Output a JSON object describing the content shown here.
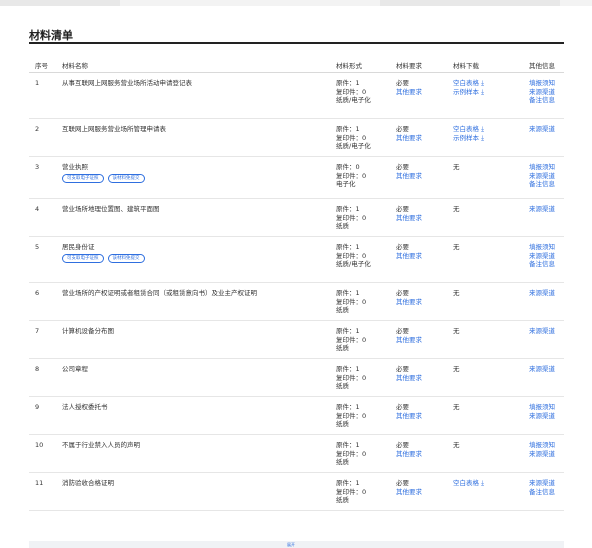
{
  "page": {
    "title": "材料清单"
  },
  "table": {
    "headers": {
      "no": "序号",
      "name": "材料名称",
      "form": "材料形式",
      "req": "材料要求",
      "download": "材料下载",
      "other": "其他信息"
    },
    "rows": [
      {
        "no": "1",
        "name": "从事互联网上网服务营业场所活动申请登记表",
        "tags": [],
        "form": [
          "原件：1",
          "复印件：0",
          "纸质/电子化"
        ],
        "req": "必要",
        "req_link": "其他要求",
        "download": [
          "空白表格 ⤓",
          "示例样本 ⤓"
        ],
        "other": [
          "填报须知",
          "来源渠道",
          "备注信息"
        ]
      },
      {
        "no": "2",
        "name": "互联网上网服务营业场所管理申请表",
        "tags": [],
        "form": [
          "原件：1",
          "复印件：0",
          "纸质/电子化"
        ],
        "req": "必要",
        "req_link": "其他要求",
        "download": [
          "空白表格 ⤓",
          "示例样本 ⤓"
        ],
        "other": [
          "来源渠道"
        ]
      },
      {
        "no": "3",
        "name": "营业执照",
        "tags": [
          "可支取电子证照",
          "该材料免提交"
        ],
        "form": [
          "原件：0",
          "复印件：0",
          "电子化"
        ],
        "req": "必要",
        "req_link": "其他要求",
        "download_none": "无",
        "other": [
          "填报须知",
          "来源渠道",
          "备注信息"
        ]
      },
      {
        "no": "4",
        "name": "营业场所地理位置图、建筑平面图",
        "tags": [],
        "form": [
          "原件：1",
          "复印件：0",
          "纸质"
        ],
        "req": "必要",
        "req_link": "其他要求",
        "download_none": "无",
        "other": [
          "来源渠道"
        ]
      },
      {
        "no": "5",
        "name": "居民身份证",
        "tags": [
          "可支取电子证照",
          "该材料免提交"
        ],
        "form": [
          "原件：1",
          "复印件：0",
          "纸质/电子化"
        ],
        "req": "必要",
        "req_link": "其他要求",
        "download_none": "无",
        "other": [
          "填报须知",
          "来源渠道",
          "备注信息"
        ]
      },
      {
        "no": "6",
        "name": "营业场所的产权证明或者租赁合同（或租赁意向书）及业主产权证明",
        "tags": [],
        "form": [
          "原件：1",
          "复印件：0",
          "纸质"
        ],
        "req": "必要",
        "req_link": "其他要求",
        "download_none": "无",
        "other": [
          "来源渠道"
        ]
      },
      {
        "no": "7",
        "name": "计算机设备分布图",
        "tags": [],
        "form": [
          "原件：1",
          "复印件：0",
          "纸质"
        ],
        "req": "必要",
        "req_link": "其他要求",
        "download_none": "无",
        "other": [
          "来源渠道"
        ]
      },
      {
        "no": "8",
        "name": "公司章程",
        "tags": [],
        "form": [
          "原件：1",
          "复印件：0",
          "纸质"
        ],
        "req": "必要",
        "req_link": "其他要求",
        "download_none": "无",
        "other": [
          "来源渠道"
        ]
      },
      {
        "no": "9",
        "name": "法人授权委托书",
        "tags": [],
        "form": [
          "原件：1",
          "复印件：0",
          "纸质"
        ],
        "req": "必要",
        "req_link": "其他要求",
        "download_none": "无",
        "other": [
          "填报须知",
          "来源渠道"
        ]
      },
      {
        "no": "10",
        "name": "不属于行业禁入人员的声明",
        "tags": [],
        "form": [
          "原件：1",
          "复印件：0",
          "纸质"
        ],
        "req": "必要",
        "req_link": "其他要求",
        "download_none": "无",
        "other": [
          "填报须知",
          "来源渠道"
        ]
      },
      {
        "no": "11",
        "name": "消防验收合格证明",
        "tags": [],
        "form": [
          "原件：1",
          "复印件：0",
          "纸质"
        ],
        "req": "必要",
        "req_link": "其他要求",
        "download": [
          "空白表格 ⤓"
        ],
        "other": [
          "来源渠道",
          "备注信息"
        ]
      }
    ]
  },
  "footer": {
    "more_label": "展开"
  },
  "colors": {
    "link": "#2f6fdf",
    "rule": "#222222",
    "row_border": "#e6e6e6"
  }
}
